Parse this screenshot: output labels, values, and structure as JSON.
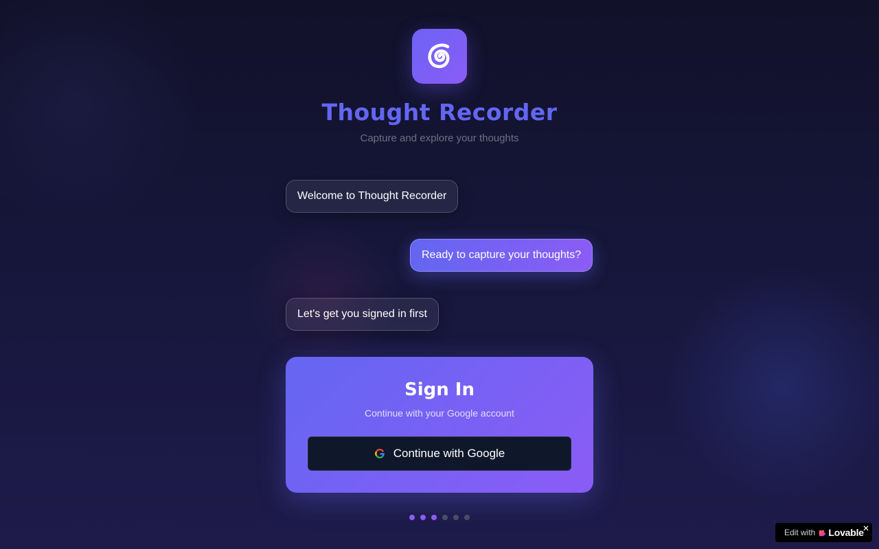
{
  "header": {
    "logo_icon": "spiral-icon",
    "title": "Thought Recorder",
    "subtitle": "Capture and explore your thoughts"
  },
  "messages": [
    {
      "text": "Welcome to Thought Recorder",
      "side": "left"
    },
    {
      "text": "Ready to capture your thoughts?",
      "side": "right"
    },
    {
      "text": "Let's get you signed in first",
      "side": "left"
    }
  ],
  "signin": {
    "title": "Sign In",
    "subtitle": "Continue with your Google account",
    "button_label": "Continue with Google",
    "button_icon": "google-icon"
  },
  "progress": {
    "total_steps": 6,
    "completed_steps": 3
  },
  "badge": {
    "prefix": "Edit with",
    "brand": "Lovable",
    "close": "✕"
  },
  "colors": {
    "accent": "#6366f1",
    "accent_secondary": "#8b5cf6",
    "background": "#16163a",
    "button_dark": "#0f172a"
  }
}
